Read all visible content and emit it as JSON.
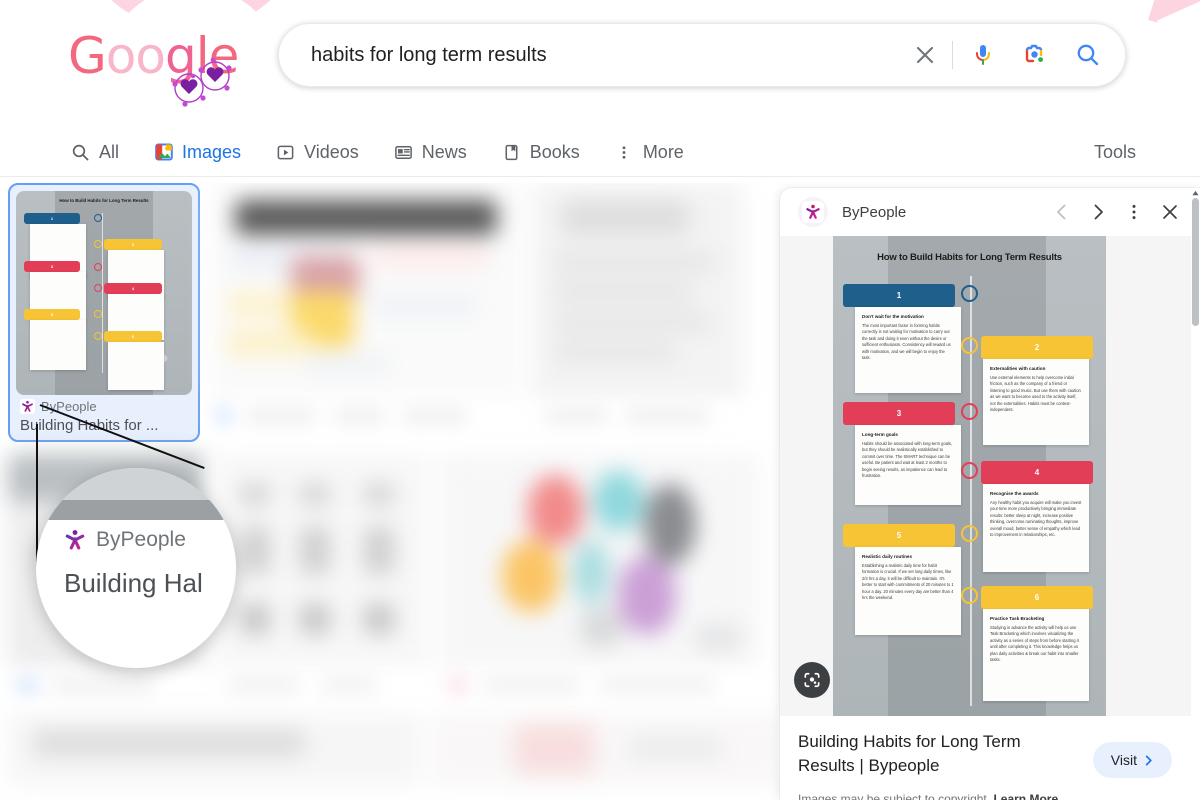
{
  "header": {
    "logo_text": "Google",
    "logo_alt": "google-valentines-doodle",
    "colors": {
      "logo_pink": "#f4687f",
      "logo_purple": "#8e24aa",
      "doodle_bow": "#fcd5e0",
      "accent_blue": "#1a73e8"
    }
  },
  "search": {
    "value": "habits for long term results",
    "placeholder": "Search",
    "clear_label": "Clear",
    "voice_label": "Search by voice",
    "lens_label": "Search by image",
    "submit_label": "Google Search"
  },
  "nav": {
    "tabs": [
      {
        "label": "All",
        "icon": "search-icon",
        "active": false
      },
      {
        "label": "Images",
        "icon": "images-icon",
        "active": true
      },
      {
        "label": "Videos",
        "icon": "video-icon",
        "active": false
      },
      {
        "label": "News",
        "icon": "news-icon",
        "active": false
      },
      {
        "label": "Books",
        "icon": "book-icon",
        "active": false
      },
      {
        "label": "More",
        "icon": "kebab-icon",
        "active": false
      }
    ],
    "tools_label": "Tools"
  },
  "results": {
    "selected": {
      "site": "ByPeople",
      "title": "Building Habits for ...",
      "favicon": "bypeople-x-icon"
    },
    "blurred_count": 8
  },
  "magnifier": {
    "site": "ByPeople",
    "title": "Building Hal"
  },
  "panel": {
    "site": "ByPeople",
    "favicon": "bypeople-x-icon",
    "prev_label": "Previous image",
    "next_label": "Next image",
    "menu_label": "More options",
    "close_label": "Close",
    "lens_button_label": "Search inside image",
    "title": "Building Habits for Long Term Results | Bypeople",
    "visit_label": "Visit",
    "copyright_text": "Images may be subject to copyright.",
    "copyright_link": "Learn More"
  },
  "infographic": {
    "title": "How to Build Habits for Long Term Results",
    "items": [
      {
        "number": "1",
        "color": "#1f5f8b",
        "heading": "Don't wait for the motivation",
        "body": "The most important factor in forming habits correctly is not waiting for motivation to carry out the task and doing it even without the desire or sufficient enthusiasm. Consistency will reward us with motivation, and we will begin to enjoy the task."
      },
      {
        "number": "2",
        "color": "#f7c435",
        "heading": "Externalities with caution",
        "body": "Use external elements to help overcome initial friction, such as the company of a friend or listening to good music. But use them with caution as we want to become used to the activity itself, not the externalities. Habits must be context-independent."
      },
      {
        "number": "3",
        "color": "#e23e57",
        "heading": "Long-term goals",
        "body": "Habits should be associated with long-term goals, but they should be realistically established to commit over time. The SMART technique can be useful. Be patient and wait at least 2 months to begin seeing results, as impatience can lead to frustration."
      },
      {
        "number": "4",
        "color": "#e23e57",
        "heading": "Recognise the awards",
        "body": "Any healthy habit you acquire will make you invest your time more productively bringing immediate results: better sleep at night, increase positive thinking, overcome ruminating thoughts, improve overall mood, better sense of empathy which lead to improvement in relationships, etc."
      },
      {
        "number": "5",
        "color": "#f7c435",
        "heading": "Realistic daily routines",
        "body": "Establishing a realistic daily time for habit formation is crucial. If we set long daily times, like 2/3 hrs a day, it will be difficult to maintain. It's better to start with commitments of 20 minutes to 1 hour a day. 20 minutes every day are better than 4 hrs the weekend."
      },
      {
        "number": "6",
        "color": "#f7c435",
        "heading": "Practice Task Bracketing",
        "body": "Studying in advance the activity will help us use Task Bracketing which involves visualizing the activity as a series of steps from before starting it until after completing it. This knowledge helps us plan daily activities & break our habit into smaller tasks."
      }
    ]
  }
}
